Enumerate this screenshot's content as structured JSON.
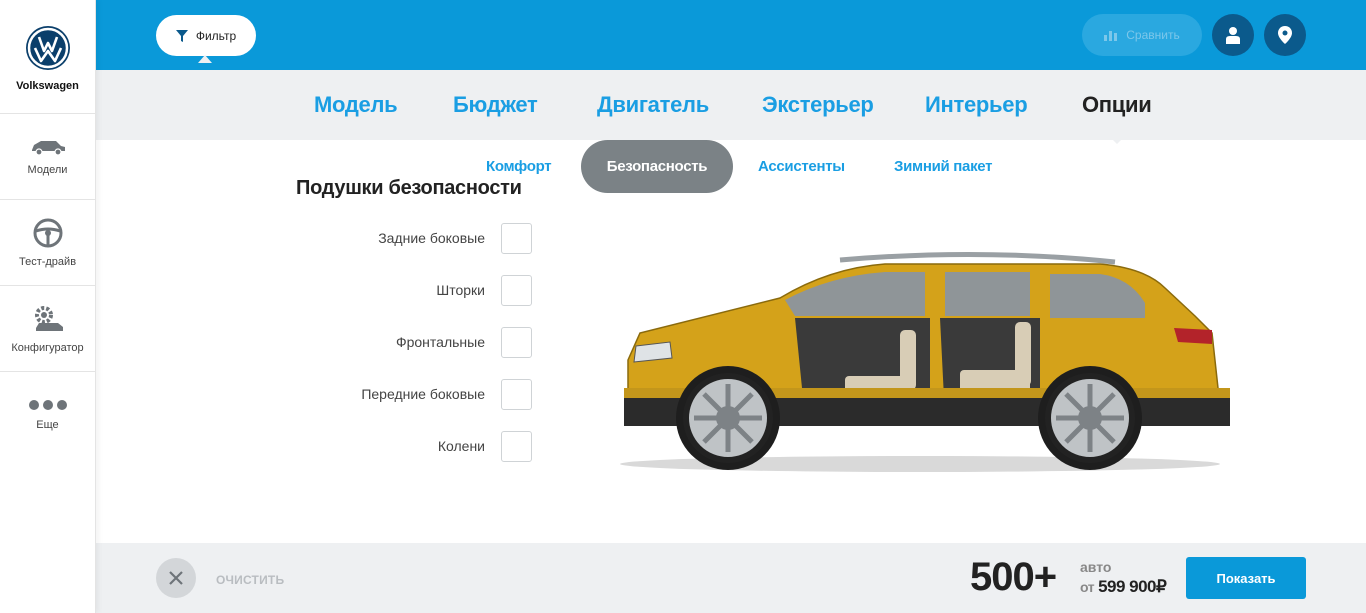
{
  "brand": {
    "name": "Volkswagen",
    "logo": "vw-logo"
  },
  "sidebar": {
    "items": [
      {
        "label": "Модели",
        "icon": "car-icon"
      },
      {
        "label": "Тест-драйв",
        "icon": "steering-wheel-icon"
      },
      {
        "label": "Конфигуратор",
        "icon": "gear-car-icon"
      },
      {
        "label": "Еще",
        "icon": "more-dots-icon"
      }
    ]
  },
  "topbar": {
    "filter_label": "Фильтр",
    "compare_label": "Сравнить",
    "colors": {
      "bar": "#0a99d9",
      "round_button": "#0b5a8c"
    }
  },
  "categories": {
    "tabs": [
      "Модель",
      "Бюджет",
      "Двигатель",
      "Экстерьер",
      "Интерьер",
      "Опции"
    ],
    "active": "Опции"
  },
  "subtabs": {
    "tabs": [
      "Комфорт",
      "Безопасность",
      "Ассистенты",
      "Зимний пакет"
    ],
    "active": "Безопасность"
  },
  "options": {
    "title": "Подушки безопасности",
    "items": [
      {
        "label": "Задние боковые",
        "checked": false
      },
      {
        "label": "Шторки",
        "checked": false
      },
      {
        "label": "Фронтальные",
        "checked": false
      },
      {
        "label": "Передние боковые",
        "checked": false
      },
      {
        "label": "Колени",
        "checked": false
      }
    ]
  },
  "footer": {
    "clear_label": "ОЧИСТИТЬ",
    "count": "500+",
    "auto_label": "авто",
    "price_prefix": "от",
    "price": "599 900₽",
    "show_label": "Показать"
  },
  "car": {
    "color": "#d4a21a"
  }
}
